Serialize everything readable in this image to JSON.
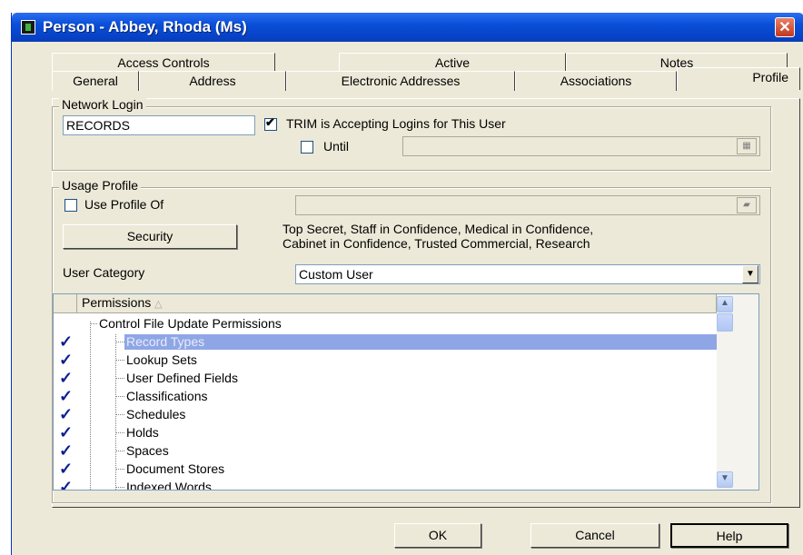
{
  "window": {
    "title": "Person - Abbey, Rhoda (Ms)",
    "close_symbol": "✕"
  },
  "tabs_row1": [
    "Access Controls",
    "Active",
    "Notes"
  ],
  "tabs_row2": [
    "General",
    "Address",
    "Electronic Addresses",
    "Associations",
    "Profile"
  ],
  "active_tab": "Profile",
  "network_login": {
    "group_label": "Network Login",
    "login_value": "RECORDS",
    "accepting_label": "TRIM is Accepting Logins for This User",
    "accepting_checked": true,
    "until_label": "Until",
    "until_checked": false,
    "until_value": ""
  },
  "usage_profile": {
    "group_label": "Usage Profile",
    "use_profile_label": "Use Profile Of",
    "use_profile_checked": false,
    "use_profile_value": "",
    "security_button": "Security",
    "security_text_line1": "Top Secret, Staff in Confidence, Medical in Confidence,",
    "security_text_line2": "Cabinet in Confidence, Trusted Commercial, Research",
    "user_category_label": "User Category",
    "user_category_value": "Custom User"
  },
  "permissions": {
    "header": "Permissions",
    "sort_indicator": "△",
    "group_title": "Control File Update Permissions",
    "check_symbol": "✓",
    "items": [
      {
        "label": "Record Types",
        "checked": true,
        "selected": true
      },
      {
        "label": "Lookup Sets",
        "checked": true,
        "selected": false
      },
      {
        "label": "User Defined Fields",
        "checked": true,
        "selected": false
      },
      {
        "label": "Classifications",
        "checked": true,
        "selected": false
      },
      {
        "label": "Schedules",
        "checked": true,
        "selected": false
      },
      {
        "label": "Holds",
        "checked": true,
        "selected": false
      },
      {
        "label": "Spaces",
        "checked": true,
        "selected": false
      },
      {
        "label": "Document Stores",
        "checked": true,
        "selected": false
      },
      {
        "label": "Indexed Words",
        "checked": true,
        "selected": false
      }
    ]
  },
  "buttons": {
    "ok": "OK",
    "cancel": "Cancel",
    "help": "Help"
  },
  "colors": {
    "titlebar": "#0a4fd8",
    "dialog_bg": "#ece9d8",
    "selection": "#8fa6e6",
    "checkmark": "#0a1f8f",
    "close_button": "#c2381c"
  }
}
